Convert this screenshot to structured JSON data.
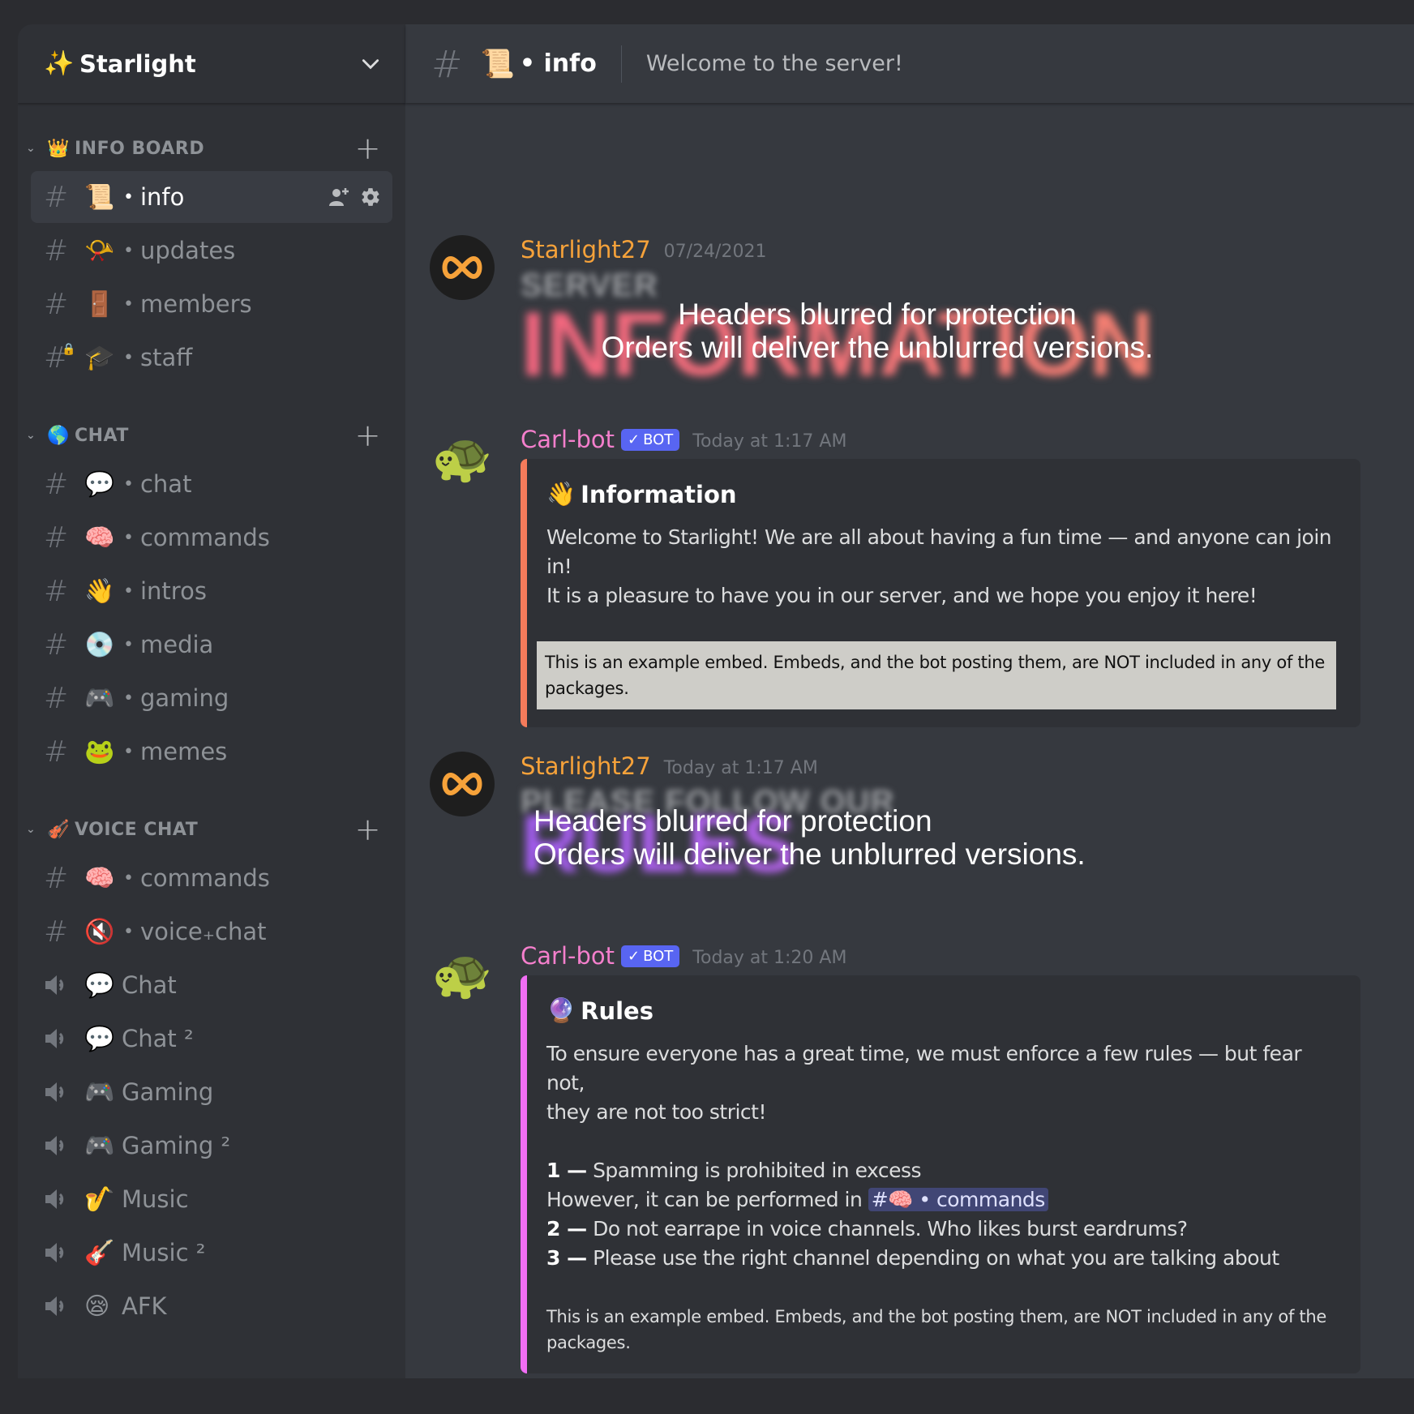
{
  "server": {
    "name": "Starlight",
    "emoji": "✨"
  },
  "sidebar": {
    "categories": [
      {
        "label": "INFO BOARD",
        "emoji": "👑",
        "channels": [
          {
            "type": "text",
            "emoji": "📜",
            "name": "info",
            "active": true
          },
          {
            "type": "text",
            "emoji": "📯",
            "name": "updates"
          },
          {
            "type": "text",
            "emoji": "🚪",
            "name": "members"
          },
          {
            "type": "text-locked",
            "emoji": "🎓",
            "name": "staff"
          }
        ]
      },
      {
        "label": "CHAT",
        "emoji": "🌎",
        "channels": [
          {
            "type": "text",
            "emoji": "💬",
            "name": "chat"
          },
          {
            "type": "text",
            "emoji": "🧠",
            "name": "commands"
          },
          {
            "type": "text",
            "emoji": "👋",
            "name": "intros"
          },
          {
            "type": "text",
            "emoji": "💿",
            "name": "media"
          },
          {
            "type": "text",
            "emoji": "🎮",
            "name": "gaming"
          },
          {
            "type": "text",
            "emoji": "🐸",
            "name": "memes"
          }
        ]
      },
      {
        "label": "VOICE CHAT",
        "emoji": "🎻",
        "channels": [
          {
            "type": "text",
            "emoji": "🧠",
            "name": "commands"
          },
          {
            "type": "text",
            "emoji": "🔇",
            "name": "voice₊chat"
          },
          {
            "type": "voice",
            "emoji": "💬",
            "name": "Chat"
          },
          {
            "type": "voice",
            "emoji": "💬",
            "name": "Chat ²"
          },
          {
            "type": "voice",
            "emoji": "🎮",
            "name": "Gaming"
          },
          {
            "type": "voice",
            "emoji": "🎮",
            "name": "Gaming ²"
          },
          {
            "type": "voice",
            "emoji": "🎷",
            "name": "Music"
          },
          {
            "type": "voice",
            "emoji": "🎸",
            "name": "Music ²"
          },
          {
            "type": "voice",
            "emoji": "😪",
            "name": "AFK"
          }
        ]
      }
    ],
    "icons": {
      "channel_active_actions": [
        "add-member-icon",
        "gear-icon"
      ]
    }
  },
  "topbar": {
    "emoji": "📜",
    "channel": "• info",
    "topic": "Welcome to the server!"
  },
  "messages": [
    {
      "author": "Starlight27",
      "timestamp": "07/24/2021",
      "blurred_small": "SERVER",
      "blurred_big": "INFORMATION",
      "overlay_line1": "Headers blurred for protection",
      "overlay_line2": "Orders will deliver the unblurred versions."
    },
    {
      "author": "Carl-bot",
      "bot_tag": "BOT",
      "timestamp": "Today at 1:17 AM",
      "embed": {
        "color": "#f47b5b",
        "title_emoji": "👋",
        "title": "Information",
        "desc_line1": "Welcome to Starlight! We are all about having a fun time — and anyone can join in!",
        "desc_line2": "It is a pleasure to have you in our server, and we hope you enjoy it here!",
        "note": "This is an example embed. Embeds, and the bot posting them, are NOT included in any of the packages."
      }
    },
    {
      "author": "Starlight27",
      "timestamp": "Today at 1:17 AM",
      "blurred_small": "PLEASE FOLLOW OUR",
      "blurred_big": "RULES",
      "overlay_line1": "Headers blurred for protection",
      "overlay_line2": "Orders will deliver the unblurred versions."
    },
    {
      "author": "Carl-bot",
      "bot_tag": "BOT",
      "timestamp": "Today at 1:20 AM",
      "embed": {
        "color": "#f16ef4",
        "title_emoji": "🔮",
        "title": "Rules",
        "desc_line1": "To ensure everyone has a great time, we must enforce a few rules — but fear not,",
        "desc_line2": "they are not too strict!",
        "rules": [
          {
            "num": "1 —",
            "text": "Spamming is prohibited in excess"
          },
          {
            "num": "2 —",
            "text": "Do not earrape in voice channels. Who likes burst eardrums?"
          },
          {
            "num": "3 —",
            "text": "Please use the right channel depending on what you are talking about"
          }
        ],
        "rule1_followup": "However, it can be performed in",
        "mention": {
          "hash": "#",
          "emoji": "🧠",
          "name": "• commands"
        },
        "note": "This is an example embed. Embeds, and the bot posting them, are NOT included in any of the packages."
      }
    }
  ]
}
